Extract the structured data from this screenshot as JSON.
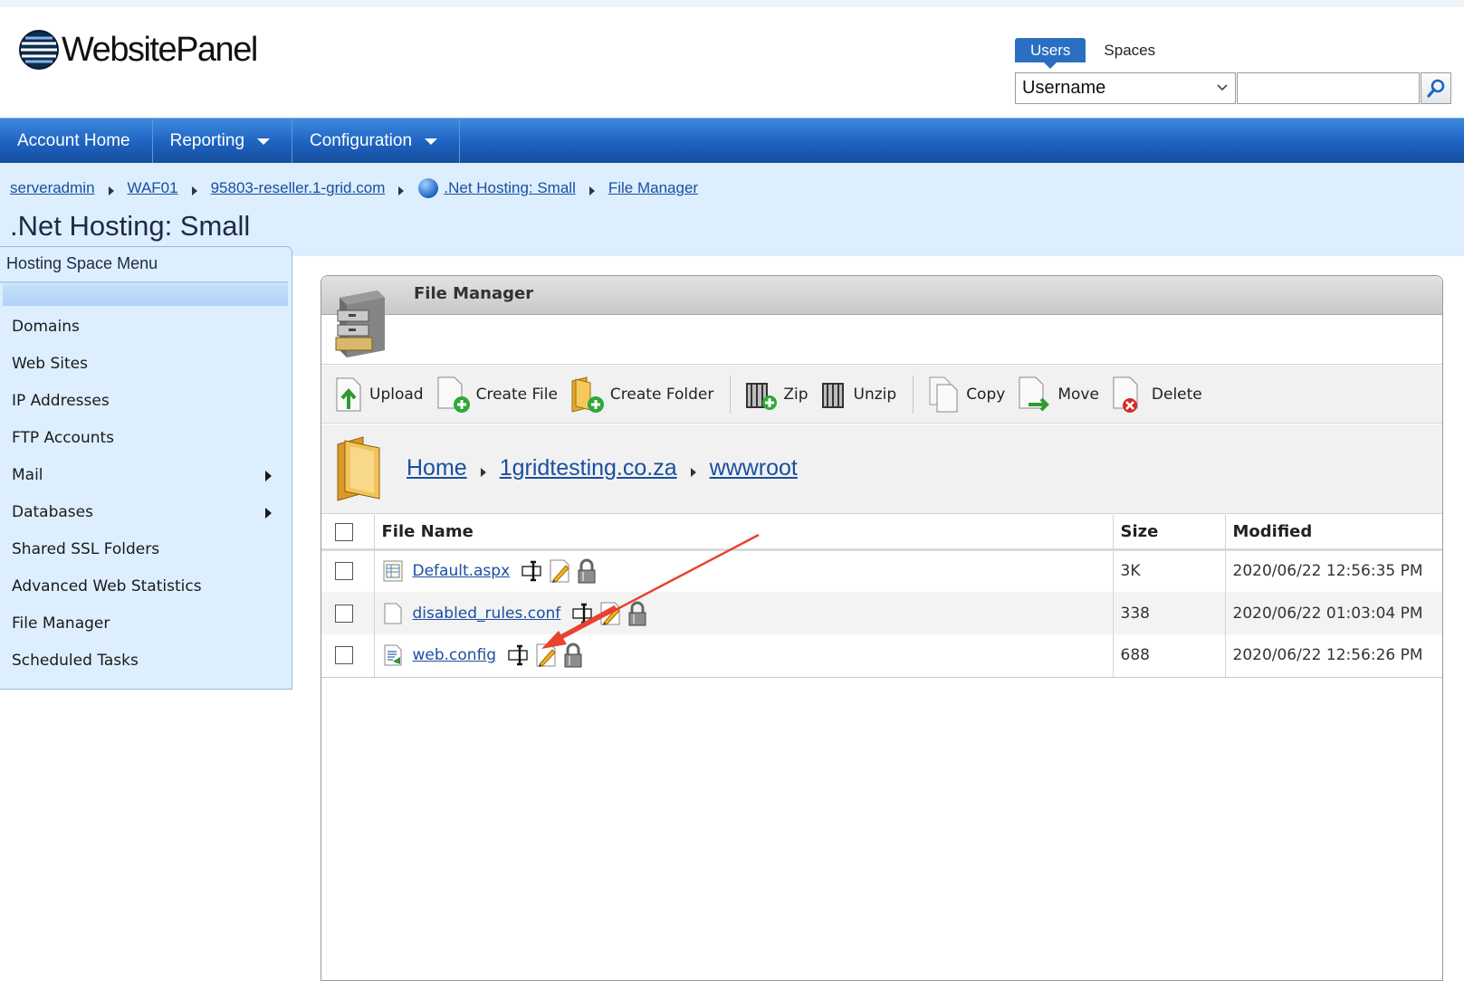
{
  "header": {
    "logo_text": "WebsitePanel",
    "search_tabs": [
      "Users",
      "Spaces"
    ],
    "search_select_value": "Username",
    "search_input_value": ""
  },
  "nav": {
    "items": [
      {
        "label": "Account Home",
        "dropdown": false
      },
      {
        "label": "Reporting",
        "dropdown": true
      },
      {
        "label": "Configuration",
        "dropdown": true
      }
    ]
  },
  "breadcrumb": [
    "serveradmin",
    "WAF01",
    "95803-reseller.1-grid.com",
    ".Net Hosting: Small",
    "File Manager"
  ],
  "page_title": ".Net Hosting: Small",
  "sidebar": {
    "title": "Hosting Space Menu",
    "items": [
      {
        "label": "Domains",
        "submenu": false
      },
      {
        "label": "Web Sites",
        "submenu": false
      },
      {
        "label": "IP Addresses",
        "submenu": false
      },
      {
        "label": "FTP Accounts",
        "submenu": false
      },
      {
        "label": "Mail",
        "submenu": true
      },
      {
        "label": "Databases",
        "submenu": true
      },
      {
        "label": "Shared SSL Folders",
        "submenu": false
      },
      {
        "label": "Advanced Web Statistics",
        "submenu": false
      },
      {
        "label": "File Manager",
        "submenu": false
      },
      {
        "label": "Scheduled Tasks",
        "submenu": false
      }
    ]
  },
  "file_manager": {
    "title": "File Manager",
    "toolbar": [
      "Upload",
      "Create File",
      "Create Folder",
      "Zip",
      "Unzip",
      "Copy",
      "Move",
      "Delete"
    ],
    "path": [
      "Home",
      "1gridtesting.co.za",
      "wwwroot"
    ],
    "columns": [
      "File Name",
      "Size",
      "Modified"
    ],
    "rows": [
      {
        "name": "Default.aspx",
        "size": "3K",
        "modified": "2020/06/22 12:56:35 PM"
      },
      {
        "name": "disabled_rules.conf",
        "size": "338",
        "modified": "2020/06/22 01:03:04 PM"
      },
      {
        "name": "web.config",
        "size": "688",
        "modified": "2020/06/22 12:56:26 PM"
      }
    ]
  },
  "colors": {
    "nav_blue": "#1e62c0",
    "band_light_blue": "#ddeefe",
    "link_blue": "#1a4fa0",
    "annotation_red": "#e8432e"
  }
}
